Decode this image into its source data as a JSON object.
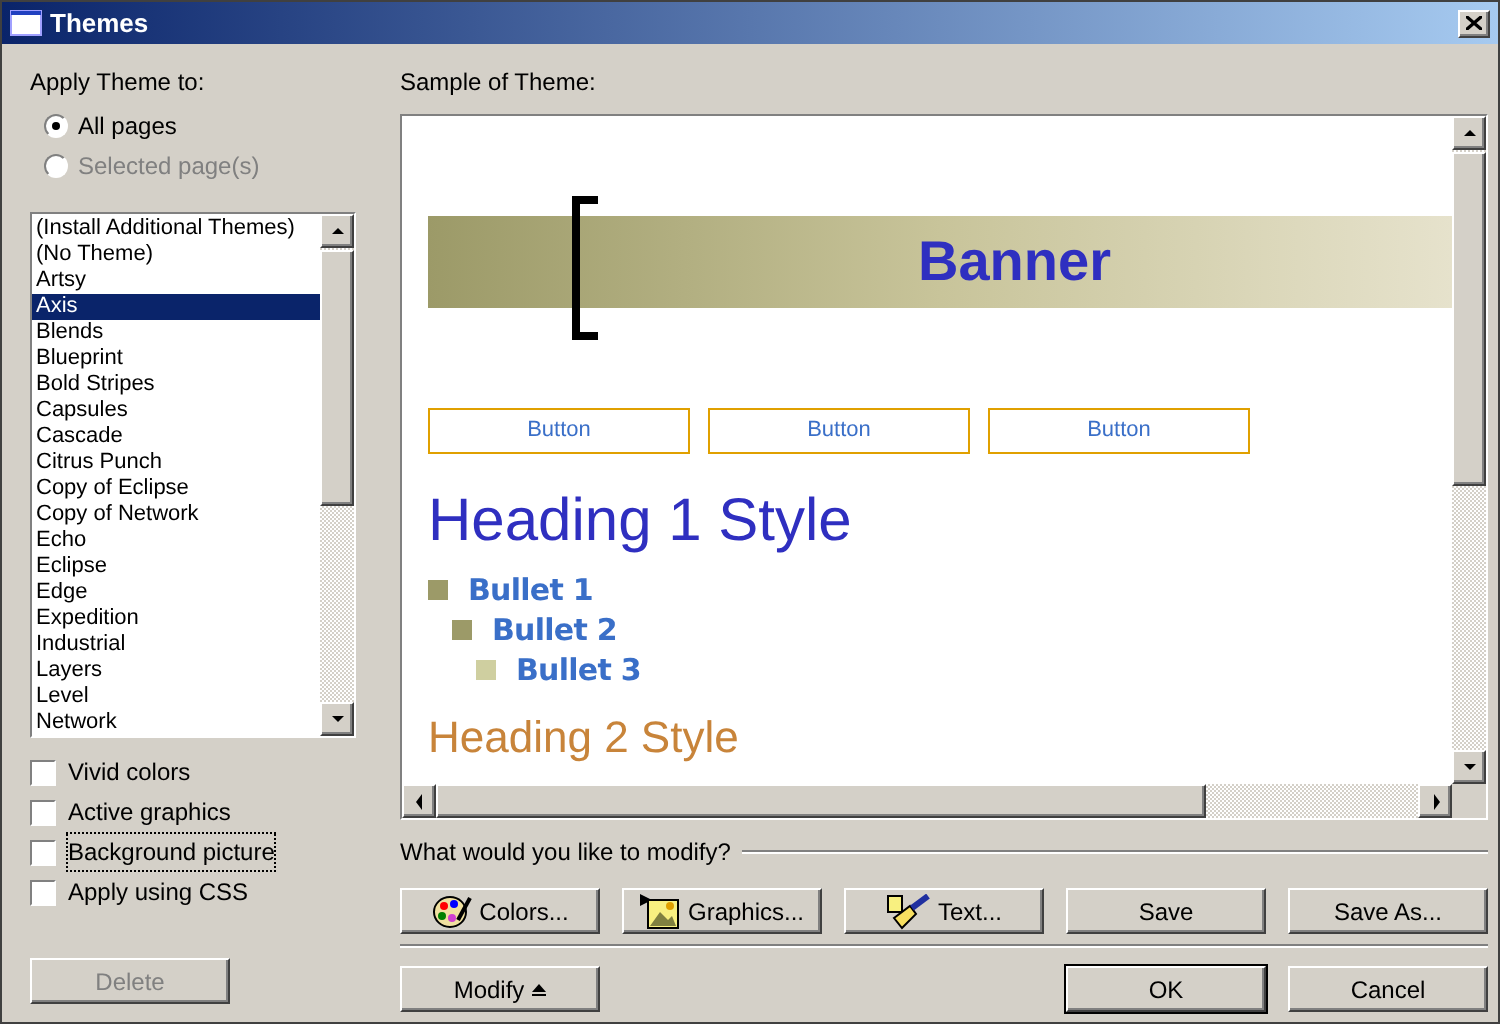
{
  "window": {
    "title": "Themes"
  },
  "apply_label": "Apply Theme to:",
  "apply_options": [
    {
      "label": "All pages",
      "selected": true,
      "disabled": false
    },
    {
      "label": "Selected page(s)",
      "selected": false,
      "disabled": true
    }
  ],
  "themes": [
    {
      "label": "(Install Additional Themes)",
      "selected": false
    },
    {
      "label": "(No Theme)",
      "selected": false
    },
    {
      "label": "Artsy",
      "selected": false
    },
    {
      "label": "Axis",
      "selected": true
    },
    {
      "label": "Blends",
      "selected": false
    },
    {
      "label": "Blueprint",
      "selected": false
    },
    {
      "label": "Bold Stripes",
      "selected": false
    },
    {
      "label": "Capsules",
      "selected": false
    },
    {
      "label": "Cascade",
      "selected": false
    },
    {
      "label": "Citrus Punch",
      "selected": false
    },
    {
      "label": "Copy of Eclipse",
      "selected": false
    },
    {
      "label": "Copy of Network",
      "selected": false
    },
    {
      "label": "Echo",
      "selected": false
    },
    {
      "label": "Eclipse",
      "selected": false
    },
    {
      "label": "Edge",
      "selected": false
    },
    {
      "label": "Expedition",
      "selected": false
    },
    {
      "label": "Industrial",
      "selected": false
    },
    {
      "label": "Layers",
      "selected": false
    },
    {
      "label": "Level",
      "selected": false
    },
    {
      "label": "Network",
      "selected": false
    }
  ],
  "options": [
    {
      "label": "Vivid colors",
      "checked": false,
      "focused": false
    },
    {
      "label": "Active graphics",
      "checked": false,
      "focused": false
    },
    {
      "label": "Background picture",
      "checked": false,
      "focused": true
    },
    {
      "label": "Apply using CSS",
      "checked": false,
      "focused": false
    }
  ],
  "delete_button": {
    "label": "Delete",
    "disabled": true
  },
  "sample_label": "Sample of Theme:",
  "sample": {
    "banner": "Banner",
    "buttons": [
      "Button",
      "Button",
      "Button"
    ],
    "heading1": "Heading 1 Style",
    "bullets": [
      {
        "label": "Bullet 1",
        "color": "#9c9a68",
        "children": [
          {
            "label": "Bullet 2",
            "color": "#9c9a68",
            "children": [
              {
                "label": "Bullet 3",
                "color": "#cfcfa0"
              }
            ]
          }
        ]
      }
    ],
    "heading2": "Heading 2 Style"
  },
  "modify_label": "What would you like to modify?",
  "modify_buttons": [
    {
      "label": "Colors...",
      "kind": "colors"
    },
    {
      "label": "Graphics...",
      "kind": "graphics"
    },
    {
      "label": "Text...",
      "kind": "text"
    },
    {
      "label": "Save",
      "kind": "plain"
    },
    {
      "label": "Save As...",
      "kind": "plain"
    }
  ],
  "footer": {
    "modify": "Modify",
    "ok": "OK",
    "cancel": "Cancel"
  }
}
